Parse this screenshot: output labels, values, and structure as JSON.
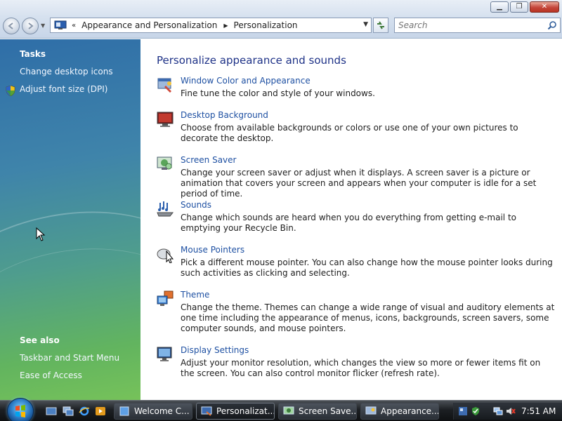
{
  "window": {
    "minimize_symbol": "▁",
    "maximize_symbol": "❐",
    "close_symbol": "✕"
  },
  "address_bar": {
    "chevrons": "«",
    "breadcrumbs": [
      "Appearance and Personalization",
      "Personalization"
    ]
  },
  "search": {
    "placeholder": "Search"
  },
  "sidebar": {
    "tasks_heading": "Tasks",
    "tasks": [
      "Change desktop icons",
      "Adjust font size (DPI)"
    ],
    "see_also_heading": "See also",
    "see_also": [
      "Taskbar and Start Menu",
      "Ease of Access"
    ]
  },
  "main": {
    "title": "Personalize appearance and sounds",
    "items": [
      {
        "icon": "window-color-icon",
        "link": "Window Color and Appearance",
        "description": "Fine tune the color and style of your windows."
      },
      {
        "icon": "desktop-background-icon",
        "link": "Desktop Background",
        "description": "Choose from available backgrounds or colors or use one of your own pictures to decorate the desktop."
      },
      {
        "icon": "screen-saver-icon",
        "link": "Screen Saver",
        "description": "Change your screen saver or adjust when it displays. A screen saver is a picture or animation that covers your screen and appears when your computer is idle for a set period of time."
      },
      {
        "icon": "sounds-icon",
        "link": "Sounds",
        "description": "Change which sounds are heard when you do everything from getting e-mail to emptying your Recycle Bin."
      },
      {
        "icon": "mouse-pointers-icon",
        "link": "Mouse Pointers",
        "description": "Pick a different mouse pointer. You can also change how the mouse pointer looks during such activities as clicking and selecting."
      },
      {
        "icon": "theme-icon",
        "link": "Theme",
        "description": "Change the theme. Themes can change a wide range of visual and auditory elements at one time including the appearance of menus, icons, backgrounds, screen savers, some computer sounds, and mouse pointers."
      },
      {
        "icon": "display-settings-icon",
        "link": "Display Settings",
        "description": "Adjust your monitor resolution, which changes the view so more or fewer items fit on the screen. You can also control monitor flicker (refresh rate)."
      }
    ]
  },
  "taskbar": {
    "tasks": [
      {
        "label": "Welcome C...",
        "icon": "welcome-center-icon",
        "active": false
      },
      {
        "label": "Personalizat...",
        "icon": "personalization-icon",
        "active": true
      },
      {
        "label": "Screen Save...",
        "icon": "screen-saver-icon",
        "active": false
      },
      {
        "label": "Appearance...",
        "icon": "appearance-icon",
        "active": false
      }
    ],
    "clock": "7:51 AM"
  },
  "colors": {
    "link": "#1e50a2",
    "title": "#1e3287",
    "sidebar_top": "#2f6ea8",
    "sidebar_bottom": "#76c25a"
  }
}
